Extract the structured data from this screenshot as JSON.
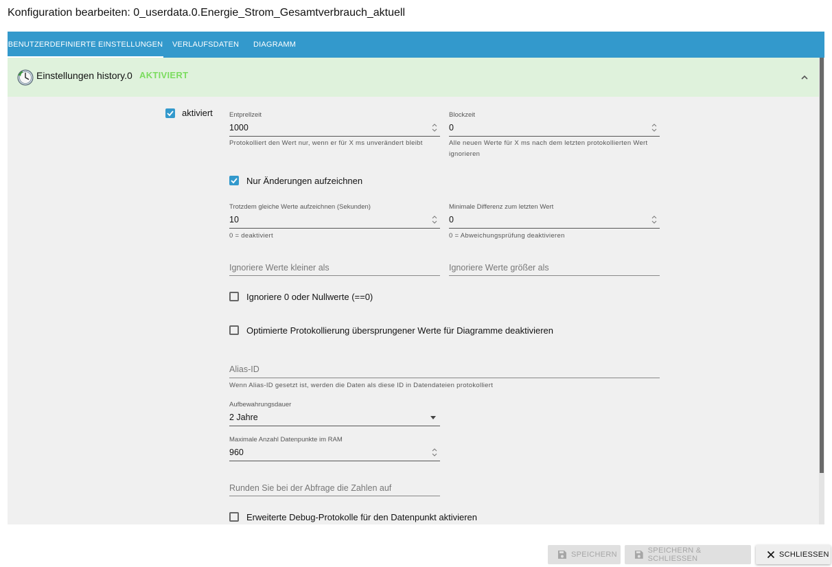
{
  "dialog": {
    "title": "Konfiguration bearbeiten: 0_userdata.0.Energie_Strom_Gesamtverbrauch_aktuell"
  },
  "tabs": [
    {
      "label": "BENUTZERDEFINIERTE EINSTELLUNGEN",
      "active": true
    },
    {
      "label": "VERLAUFSDATEN",
      "active": false
    },
    {
      "label": "DIAGRAMM",
      "active": false
    }
  ],
  "panel": {
    "title": "Einstellungen history.0",
    "status": "AKTIVIERT",
    "header_color": "#dff2dc",
    "status_color": "#7bdc5f"
  },
  "form": {
    "enabled": {
      "label": "aktiviert",
      "checked": true
    },
    "debounce": {
      "label": "Entprellzeit",
      "value": "1000",
      "helper": "Protokolliert den Wert nur, wenn er für X ms unverändert bleibt"
    },
    "blocktime": {
      "label": "Blockzeit",
      "value": "0",
      "helper": "Alle neuen Werte für X ms nach dem letzten protokollierten Wert ignorieren"
    },
    "changes_only": {
      "label": "Nur Änderungen aufzeichnen",
      "checked": true
    },
    "same_values": {
      "label": "Trotzdem gleiche Werte aufzeichnen (Sekunden)",
      "value": "10",
      "helper": "0 = deaktiviert"
    },
    "min_diff": {
      "label": "Minimale Differenz zum letzten Wert",
      "value": "0",
      "helper": "0 = Abweichungsprüfung deaktivieren"
    },
    "ignore_below": {
      "placeholder": "Ignoriere Werte kleiner als"
    },
    "ignore_above": {
      "placeholder": "Ignoriere Werte größer als"
    },
    "ignore_zero": {
      "label": "Ignoriere 0 oder Nullwerte (==0)",
      "checked": false
    },
    "disable_skipped": {
      "label": "Optimierte Protokollierung übersprungener Werte für Diagramme deaktivieren",
      "checked": false
    },
    "alias": {
      "placeholder": "Alias-ID",
      "helper": "Wenn Alias-ID gesetzt ist, werden die Daten als diese ID in Datendateien protokolliert"
    },
    "retention": {
      "label": "Aufbewahrungsdauer",
      "value": "2 Jahre"
    },
    "max_points": {
      "label": "Maximale Anzahl Datenpunkte im RAM",
      "value": "960"
    },
    "round": {
      "placeholder": "Runden Sie bei der Abfrage die Zahlen auf"
    },
    "debug": {
      "label": "Erweiterte Debug-Protokolle für den Datenpunkt aktivieren",
      "checked": false
    }
  },
  "footer": {
    "save": "SPEICHERN",
    "save_close": "SPEICHERN & SCHLIESSEN",
    "close": "SCHLIESSEN"
  },
  "icons": {
    "adapter": "history-clock-icon",
    "collapse": "chevron-up-icon",
    "save": "floppy-disk-icon",
    "close": "close-icon"
  },
  "colors": {
    "accent": "#3399cc"
  }
}
